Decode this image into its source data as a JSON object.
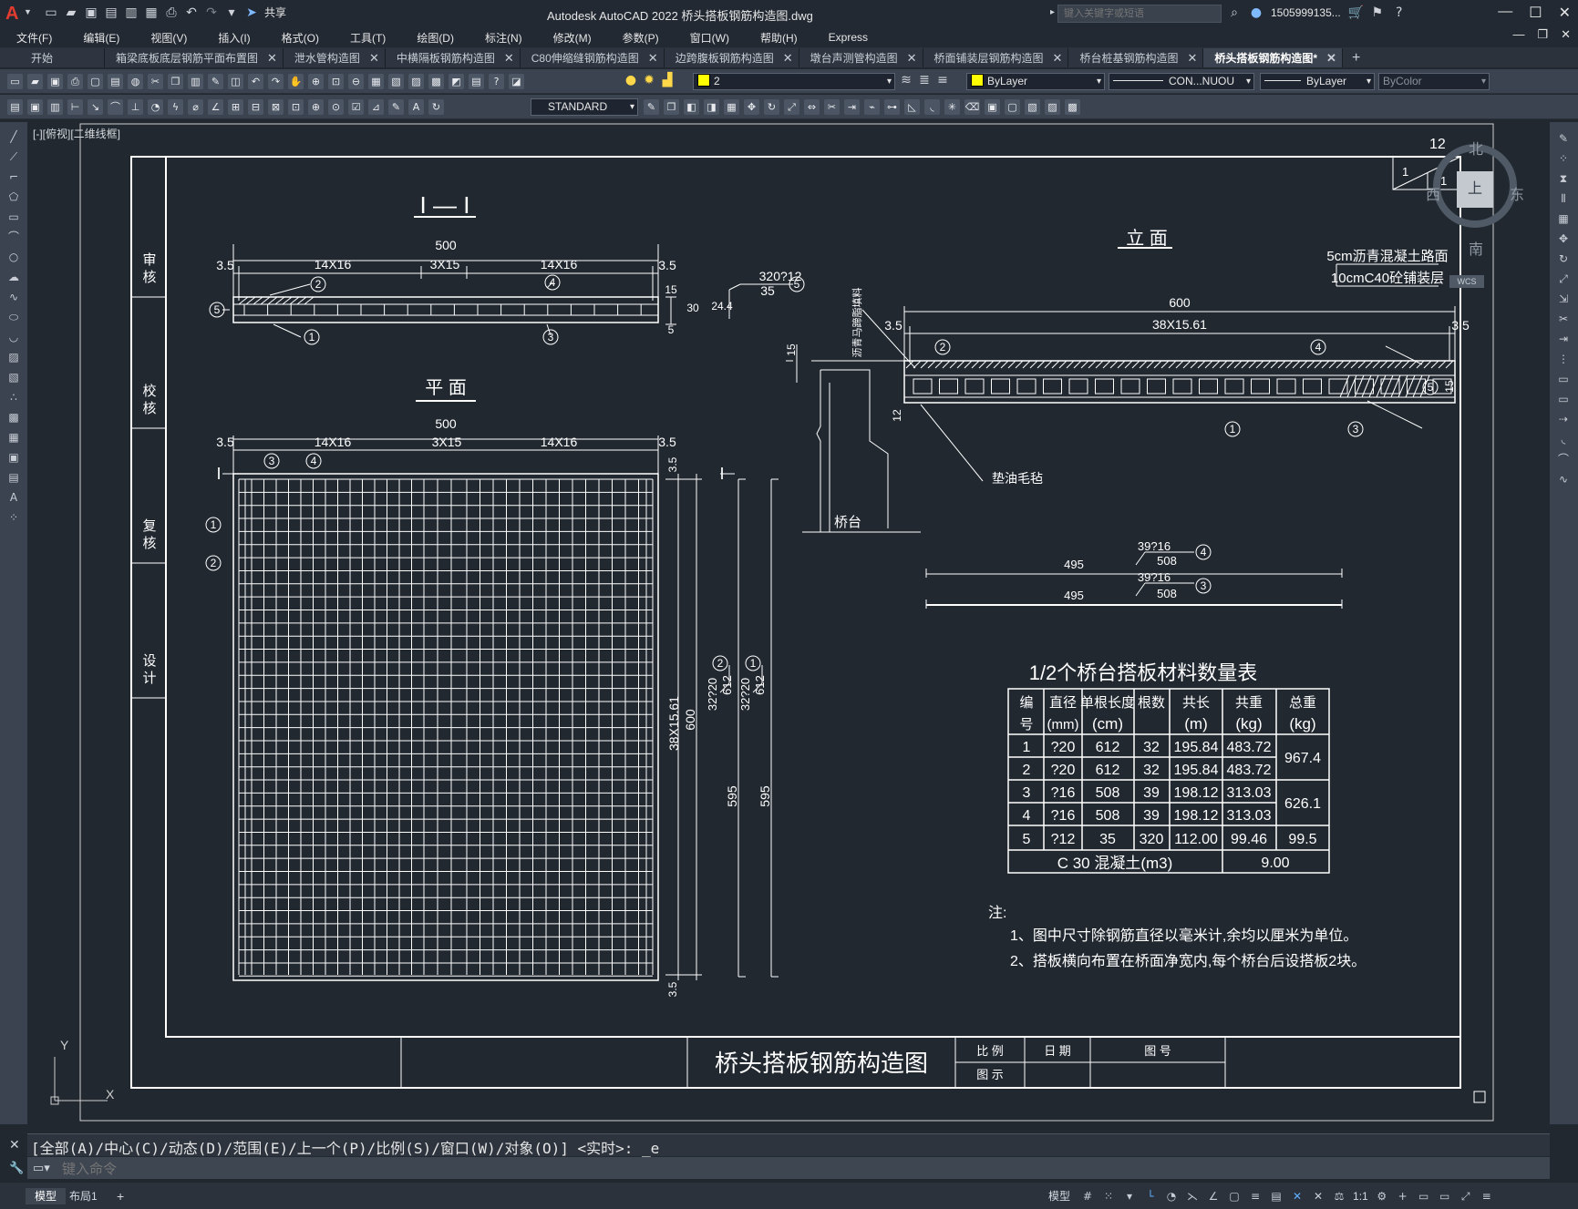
{
  "app": {
    "window_title": "Autodesk AutoCAD 2022    桥头搭板钢筋构造图.dwg",
    "share_label": "共享",
    "search_placeholder": "键入关键字或短语",
    "user": "1505999135...",
    "logo_letter": "A"
  },
  "menu": [
    "文件(F)",
    "编辑(E)",
    "视图(V)",
    "插入(I)",
    "格式(O)",
    "工具(T)",
    "绘图(D)",
    "标注(N)",
    "修改(M)",
    "参数(P)",
    "窗口(W)",
    "帮助(H)",
    "Express"
  ],
  "tabs": [
    {
      "label": "开始",
      "closable": false
    },
    {
      "label": "箱梁底板底层钢筋平面布置图",
      "closable": true
    },
    {
      "label": "泄水管构造图",
      "closable": true
    },
    {
      "label": "中横隔板钢筋构造图",
      "closable": true
    },
    {
      "label": "C80伸缩缝钢筋构造图",
      "closable": true
    },
    {
      "label": "边跨腹板钢筋构造图",
      "closable": true
    },
    {
      "label": "墩台声测管构造图",
      "closable": true
    },
    {
      "label": "桥面铺装层钢筋构造图",
      "closable": true
    },
    {
      "label": "桥台桩基钢筋构造图",
      "closable": true
    },
    {
      "label": "桥头搭板钢筋构造图*",
      "closable": true,
      "active": true
    }
  ],
  "toolbar": {
    "layer_value": "2",
    "color_value": "ByLayer",
    "linetype_value": "CON...NUOU",
    "lineweight_value": "ByLayer",
    "plotstyle_value": "ByColor",
    "textstyle_value": "STANDARD",
    "colors": {
      "layer_swatch": "#ffff00",
      "color_swatch": "#ffff00"
    }
  },
  "viewport_label": "[-][俯视][二维线框]",
  "viewcube": {
    "north": "北",
    "south": "南",
    "east": "东",
    "west": "西",
    "top": "上",
    "wcs": "WCS"
  },
  "drawing": {
    "section_title": "I — I",
    "plan_title": "平  面",
    "elevation_title": "立  面",
    "sign_labels": [
      "审核",
      "校核",
      "复核",
      "设计"
    ],
    "dims": {
      "total_500": "500",
      "d35": "3.5",
      "d14x16": "14X16",
      "d3x15": "3X15",
      "d600": "600",
      "d38x1561": "38X15.61",
      "d15": "15",
      "d5": "5",
      "d30": "30",
      "d244": "24.4",
      "d12": "12",
      "d595": "595",
      "d612": "612",
      "d508": "508",
      "d495": "495",
      "d35s": "35"
    },
    "bar_callouts": {
      "c5": "320?12",
      "c4": "39?16",
      "c3": "39?16",
      "c2": "32?20",
      "c1": "32?20"
    },
    "circle_nums": [
      "1",
      "2",
      "3",
      "4",
      "5"
    ],
    "notes_pavement_1": "5cm沥青混凝土路面",
    "notes_pavement_2": "10cmC40砼铺装层",
    "asphalt_label": "沥青马蹄脂填料",
    "felt_label": "垫油毛毡",
    "abutment_label": "桥台",
    "section_mark": "I",
    "corner_num": "12",
    "corner_1a": "1",
    "corner_1b": "1"
  },
  "table": {
    "title": "1/2个桥台搭板材料数量表",
    "headers": [
      [
        "编",
        "号"
      ],
      [
        "直径",
        "(mm)"
      ],
      [
        "单根长度",
        "(cm)"
      ],
      [
        "根数",
        ""
      ],
      [
        "共长",
        "(m)"
      ],
      [
        "共重",
        "(kg)"
      ],
      [
        "总重",
        "(kg)"
      ]
    ],
    "rows": [
      [
        "1",
        "?20",
        "612",
        "32",
        "195.84",
        "483.72"
      ],
      [
        "2",
        "?20",
        "612",
        "32",
        "195.84",
        "483.72"
      ],
      [
        "3",
        "?16",
        "508",
        "39",
        "198.12",
        "313.03"
      ],
      [
        "4",
        "?16",
        "508",
        "39",
        "198.12",
        "313.03"
      ],
      [
        "5",
        "?12",
        "35",
        "320",
        "112.00",
        "99.46"
      ]
    ],
    "totals": [
      "967.4",
      "626.1",
      "99.5"
    ],
    "concrete_label": "C 30 混凝土(m3)",
    "concrete_value": "9.00"
  },
  "notes": {
    "heading": "注:",
    "line1": "1、图中尺寸除钢筋直径以毫米计,余均以厘米为单位。",
    "line2": "2、搭板横向布置在桥面净宽内,每个桥台后设搭板2块。"
  },
  "titleblock": {
    "drawing_title": "桥头搭板钢筋构造图",
    "scale_label": "比 例",
    "date_label": "日 期",
    "sheet_label": "图  号",
    "figure_label": "图 示"
  },
  "axes": {
    "y": "Y",
    "x": "X"
  },
  "command": {
    "history": "[全部(A)/中心(C)/动态(D)/范围(E)/上一个(P)/比例(S)/窗口(W)/对象(O)] <实时>: _e",
    "placeholder": "键入命令"
  },
  "status": {
    "model_tab": "模型",
    "layout_tab": "布局1",
    "model_button": "模型",
    "scale": "1:1"
  }
}
